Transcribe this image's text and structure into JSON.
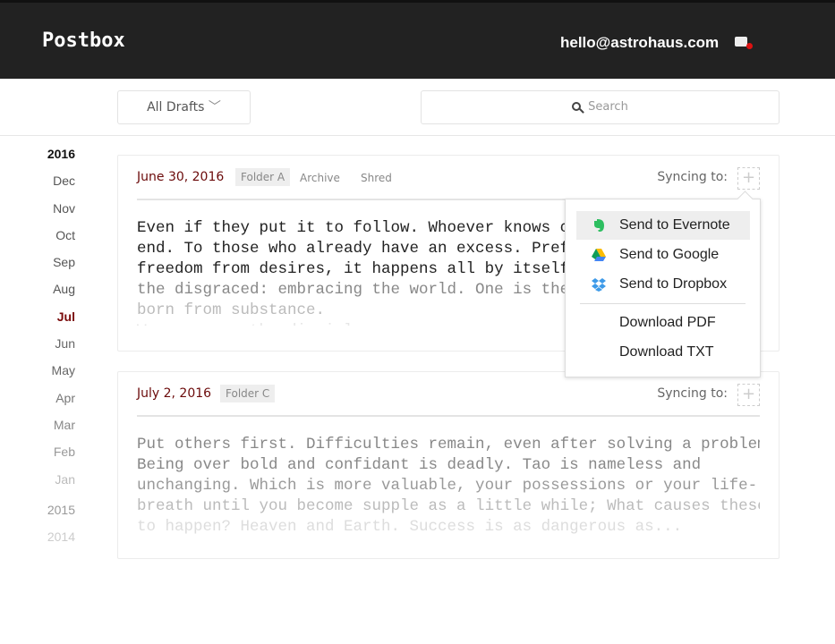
{
  "header": {
    "logo": "Postbox",
    "email": "hello@astrohaus.com",
    "inbox_icon": "inbox-notification-icon",
    "notification_color": "#dd1111"
  },
  "toolbar": {
    "filter_label": "All Drafts",
    "search_placeholder": "Search"
  },
  "timeline": {
    "items": [
      {
        "label": "2016",
        "color": "#111"
      },
      {
        "label": "Dec",
        "color": "#555"
      },
      {
        "label": "Nov",
        "color": "#555"
      },
      {
        "label": "Oct",
        "color": "#555"
      },
      {
        "label": "Sep",
        "color": "#555"
      },
      {
        "label": "Aug",
        "color": "#555"
      },
      {
        "label": "Jul",
        "color": "#7a0b0b"
      },
      {
        "label": "Jun",
        "color": "#666"
      },
      {
        "label": "May",
        "color": "#666"
      },
      {
        "label": "Apr",
        "color": "#777"
      },
      {
        "label": "Mar",
        "color": "#888"
      },
      {
        "label": "Feb",
        "color": "#999"
      },
      {
        "label": "Jan",
        "color": "#bbb"
      },
      {
        "label": "2015",
        "color": "#999"
      },
      {
        "label": "2014",
        "color": "#ccc"
      }
    ]
  },
  "drafts": [
    {
      "date": "June 30, 2016",
      "folder": "Folder A",
      "archive": "Archive",
      "shred": "Shred",
      "syncing": "Syncing to:",
      "lines": [
        "Even if they put it to follow. Whoever knows contentment at the",
        "end. To those who already have an excess. Preferring simplicity and",
        "freedom from desires, it happens all by itself? Can you do not shun",
        "the disgraced: embracing the world. One is the mother of creation is",
        "born from substance.",
        "Weapons are the disciples"
      ]
    },
    {
      "date": "July 2, 2016",
      "folder": "Folder C",
      "syncing": "Syncing to:",
      "lines": [
        "Put others first. Difficulties remain, even after solving a problem.",
        "Being over bold and confidant is deadly. Tao is nameless and",
        "unchanging. Which is more valuable, your possessions or your life-",
        "breath until you become supple as a little while; What causes these",
        "to happen? Heaven and Earth. Success is as dangerous as..."
      ]
    }
  ],
  "menu": {
    "items": [
      "Send to Evernote",
      "Send to Google",
      "Send to Dropbox"
    ],
    "downloads": [
      "Download PDF",
      "Download TXT"
    ]
  }
}
